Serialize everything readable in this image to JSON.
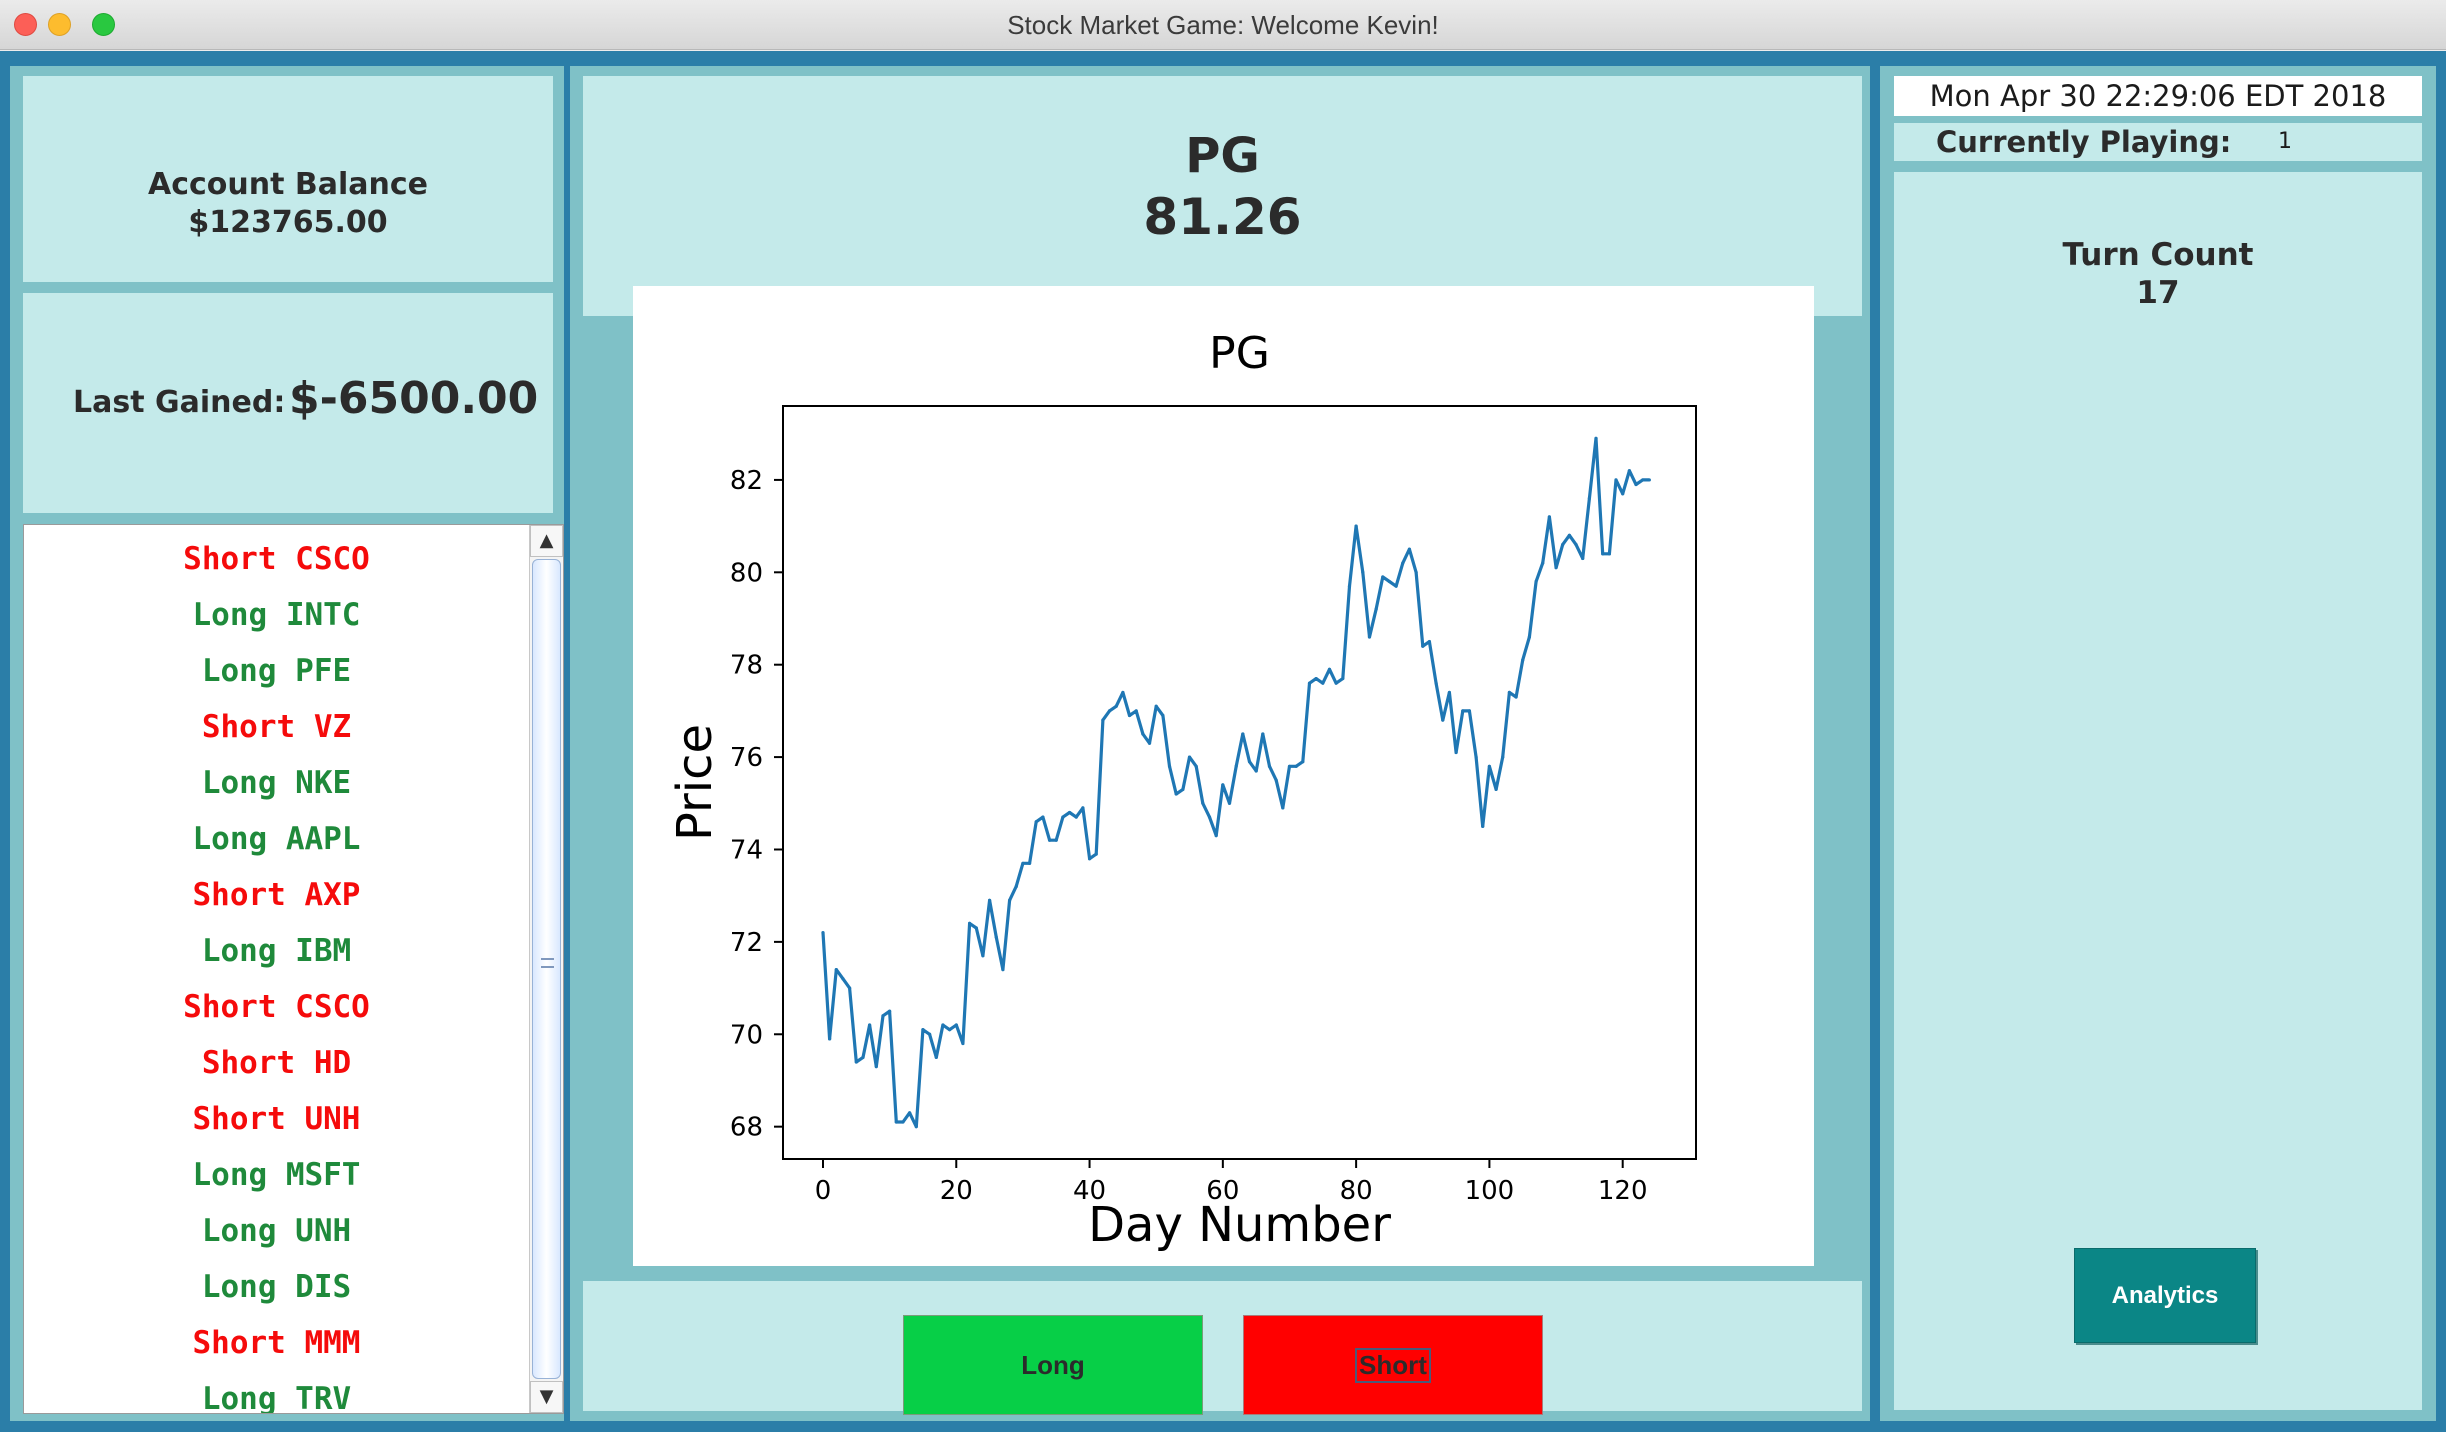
{
  "window": {
    "title": "Stock Market Game: Welcome Kevin!"
  },
  "account": {
    "label": "Account Balance",
    "value": "$123765.00"
  },
  "last_gained": {
    "label": "Last Gained:",
    "value": "$-6500.00"
  },
  "colors": {
    "long": "#1f8a3b",
    "short": "#f50b0b"
  },
  "trades": [
    {
      "text": "Short CSCO",
      "type": "short"
    },
    {
      "text": "Long INTC",
      "type": "long"
    },
    {
      "text": "Long PFE",
      "type": "long"
    },
    {
      "text": "Short VZ",
      "type": "short"
    },
    {
      "text": "Long NKE",
      "type": "long"
    },
    {
      "text": "Long AAPL",
      "type": "long"
    },
    {
      "text": "Short AXP",
      "type": "short"
    },
    {
      "text": "Long IBM",
      "type": "long"
    },
    {
      "text": "Short CSCO",
      "type": "short"
    },
    {
      "text": "Short HD",
      "type": "short"
    },
    {
      "text": "Short UNH",
      "type": "short"
    },
    {
      "text": "Long MSFT",
      "type": "long"
    },
    {
      "text": "Long UNH",
      "type": "long"
    },
    {
      "text": "Long DIS",
      "type": "long"
    },
    {
      "text": "Short MMM",
      "type": "short"
    },
    {
      "text": "Long TRV",
      "type": "long"
    }
  ],
  "ticker": {
    "symbol": "PG",
    "price": "81.26"
  },
  "buttons": {
    "long": "Long",
    "short": "Short",
    "analytics": "Analytics"
  },
  "status": {
    "datetime": "Mon Apr 30 22:29:06 EDT 2018",
    "playing_label": "Currently Playing:",
    "playing_value": "1",
    "turn_label": "Turn Count",
    "turn_value": "17"
  },
  "chart_data": {
    "type": "line",
    "title": "PG",
    "xlabel": "Day Number",
    "ylabel": "Price",
    "xlim": [
      -6,
      131
    ],
    "ylim": [
      67.3,
      83.6
    ],
    "xticks": [
      0,
      20,
      40,
      60,
      80,
      100,
      120
    ],
    "yticks": [
      68,
      70,
      72,
      74,
      76,
      78,
      80,
      82
    ],
    "series": [
      {
        "color": "#1f77b4",
        "x": [
          0,
          1,
          2,
          3,
          4,
          5,
          6,
          7,
          8,
          9,
          10,
          11,
          12,
          13,
          14,
          15,
          16,
          17,
          18,
          19,
          20,
          21,
          22,
          23,
          24,
          25,
          26,
          27,
          28,
          29,
          30,
          31,
          32,
          33,
          34,
          35,
          36,
          37,
          38,
          39,
          40,
          41,
          42,
          43,
          44,
          45,
          46,
          47,
          48,
          49,
          50,
          51,
          52,
          53,
          54,
          55,
          56,
          57,
          58,
          59,
          60,
          61,
          62,
          63,
          64,
          65,
          66,
          67,
          68,
          69,
          70,
          71,
          72,
          73,
          74,
          75,
          76,
          77,
          78,
          79,
          80,
          81,
          82,
          83,
          84,
          85,
          86,
          87,
          88,
          89,
          90,
          91,
          92,
          93,
          94,
          95,
          96,
          97,
          98,
          99,
          100,
          101,
          102,
          103,
          104,
          105,
          106,
          107,
          108,
          109,
          110,
          111,
          112,
          113,
          114,
          115,
          116,
          117,
          118,
          119,
          120,
          121,
          122,
          123,
          124
        ],
        "values": [
          72.2,
          69.9,
          71.4,
          71.2,
          71.0,
          69.4,
          69.5,
          70.2,
          69.3,
          70.4,
          70.5,
          68.1,
          68.1,
          68.3,
          68.0,
          70.1,
          70.0,
          69.5,
          70.2,
          70.1,
          70.2,
          69.8,
          72.4,
          72.3,
          71.7,
          72.9,
          72.1,
          71.4,
          72.9,
          73.2,
          73.7,
          73.7,
          74.6,
          74.7,
          74.2,
          74.2,
          74.7,
          74.8,
          74.7,
          74.9,
          73.8,
          73.9,
          76.8,
          77.0,
          77.1,
          77.4,
          76.9,
          77.0,
          76.5,
          76.3,
          77.1,
          76.9,
          75.8,
          75.2,
          75.3,
          76.0,
          75.8,
          75.0,
          74.7,
          74.3,
          75.4,
          75.0,
          75.8,
          76.5,
          75.9,
          75.7,
          76.5,
          75.8,
          75.5,
          74.9,
          75.8,
          75.8,
          75.9,
          77.6,
          77.7,
          77.6,
          77.9,
          77.6,
          77.7,
          79.7,
          81.0,
          80.0,
          78.6,
          79.2,
          79.9,
          79.8,
          79.7,
          80.2,
          80.5,
          80.0,
          78.4,
          78.5,
          77.6,
          76.8,
          77.4,
          76.1,
          77.0,
          77.0,
          76.0,
          74.5,
          75.8,
          75.3,
          76.0,
          77.4,
          77.3,
          78.1,
          78.6,
          79.8,
          80.2,
          81.2,
          80.1,
          80.6,
          80.8,
          80.6,
          80.3,
          81.6,
          82.9,
          80.4,
          80.4,
          82.0,
          81.7,
          82.2,
          81.9,
          82.0,
          82.0
        ]
      }
    ]
  }
}
